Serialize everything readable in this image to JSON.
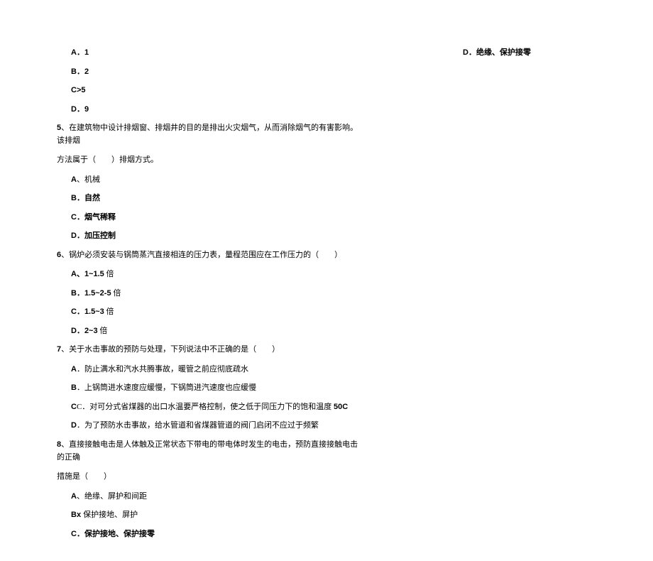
{
  "leftColumn": {
    "q4_options": {
      "a": "A．1",
      "b": "B．2",
      "c": "C>5",
      "d": "D．9"
    },
    "q5": {
      "text_a": "5",
      "text_b": "、在建筑物中设计排烟窗、排烟井的目的是排出火灾烟气，从而消除烟气的有害影响。该排烟",
      "cont": "方法属于（　　）排烟方式。",
      "options": {
        "a_letter": "A",
        "a_text": "、机械",
        "b": "B．自然",
        "c": "C．烟气稀释",
        "d": "D．加压控制"
      }
    },
    "q6": {
      "text_a": "6",
      "text_b": "、锅炉必须安装与锅筒蒸汽直接相连的压力表，量程范围应在工作压力的（　　）",
      "options": {
        "a": "A、1~1.5",
        "a_suffix": " 倍",
        "b": "B．1.5~2-5",
        "b_suffix": " 倍",
        "c": "C．1.5~3",
        "c_suffix": " 倍",
        "d": "D．2~3",
        "d_suffix": " 倍"
      }
    },
    "q7": {
      "text_a": "7",
      "text_b": "、关于水击事故的预防与处理，下列说法中不正确的是（　　）",
      "options": {
        "a": "A．防止满水和汽水共腾事故，暖管之前应彻底疏水",
        "b": "B．上锅筒进水速度应缓慢，下锅筒进汽速度也应缓慢",
        "c_pre": "C．对可分式省煤器的出口水温要严格控制，使之低于同压力下的饱和温度 ",
        "c_num": "50C",
        "d": "D．为了预防水击事故，给水管道和省煤器管道的阀门启闭不应过于频繁"
      }
    },
    "q8": {
      "text_a": "8",
      "text_b": "、直接接触电击是人体触及正常状态下带电的带电体时发生的电击，预防直接接触电击的正确",
      "cont": "措施是（　　）",
      "options": {
        "a_letter": "A",
        "a_text": "、绝缘、屏护和间距",
        "b_pre": "Bx ",
        "b_text": "保护接地、屏护",
        "c": "C．保护接地、保护接零"
      }
    }
  },
  "rightColumn": {
    "d": "D．绝缘、保护接零"
  }
}
